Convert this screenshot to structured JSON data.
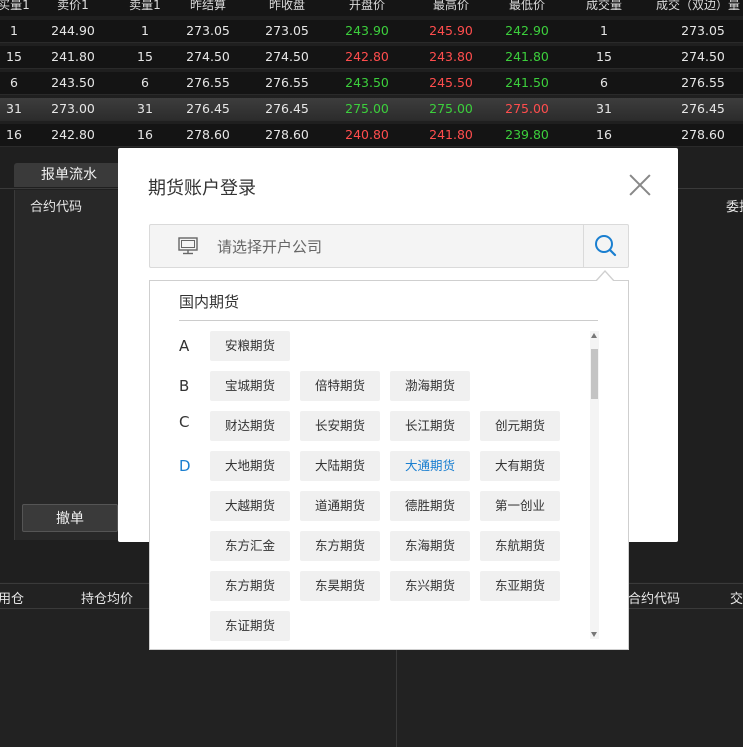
{
  "quote": {
    "headers": [
      "买量1",
      "卖价1",
      "卖量1",
      "昨结算",
      "昨收盘",
      "开盘价",
      "最高价",
      "最低价",
      "成交量",
      "成交（双边）量"
    ],
    "rows": [
      {
        "buy_vol": "1",
        "ask": "244.90",
        "ask_vol": "1",
        "pre_settle": "273.05",
        "pre_close": "273.05",
        "open": "243.90",
        "high": "245.90",
        "low": "242.90",
        "volume": "1",
        "turnover": "273.05"
      },
      {
        "buy_vol": "15",
        "ask": "241.80",
        "ask_vol": "15",
        "pre_settle": "274.50",
        "pre_close": "274.50",
        "open": "242.80",
        "high": "243.80",
        "low": "241.80",
        "volume": "15",
        "turnover": "274.50"
      },
      {
        "buy_vol": "6",
        "ask": "243.50",
        "ask_vol": "6",
        "pre_settle": "276.55",
        "pre_close": "276.55",
        "open": "243.50",
        "high": "245.50",
        "low": "241.50",
        "volume": "6",
        "turnover": "276.55"
      },
      {
        "buy_vol": "31",
        "ask": "273.00",
        "ask_vol": "31",
        "pre_settle": "276.45",
        "pre_close": "276.45",
        "open": "275.00",
        "high": "275.00",
        "low": "275.00",
        "volume": "31",
        "turnover": "276.45"
      },
      {
        "buy_vol": "16",
        "ask": "242.80",
        "ask_vol": "16",
        "pre_settle": "278.60",
        "pre_close": "278.60",
        "open": "240.80",
        "high": "241.80",
        "low": "239.80",
        "volume": "16",
        "turnover": "278.60"
      }
    ]
  },
  "order_panel": {
    "tab_label": "报单流水",
    "col_contract": "合约代码",
    "col_right": "委托",
    "cancel_label": "撤单"
  },
  "position_panel": {
    "col_left_partial": "用仓",
    "col_avg": "持仓均价",
    "col_contract": "合约代码",
    "col_right_partial": "交"
  },
  "modal": {
    "title": "期货账户登录",
    "search_placeholder": "请选择开户公司",
    "dropdown_title": "国内期货",
    "groups": [
      {
        "letter": "A",
        "items": [
          "安粮期货"
        ]
      },
      {
        "letter": "B",
        "items": [
          "宝城期货",
          "倍特期货",
          "渤海期货"
        ]
      },
      {
        "letter": "C",
        "items": [
          "财达期货",
          "长安期货",
          "长江期货",
          "创元期货"
        ]
      },
      {
        "letter": "D",
        "items": [
          "大地期货",
          "大陆期货",
          "大通期货",
          "大有期货",
          "大越期货",
          "道通期货",
          "德胜期货",
          "第一创业",
          "东方汇金",
          "东方期货",
          "东海期货",
          "东航期货",
          "东方期货",
          "东昊期货",
          "东兴期货",
          "东亚期货",
          "东证期货"
        ]
      }
    ]
  },
  "colors": {
    "up": "#ff4d4d",
    "down": "#3ccf3c",
    "active": "#1a7fd0"
  }
}
